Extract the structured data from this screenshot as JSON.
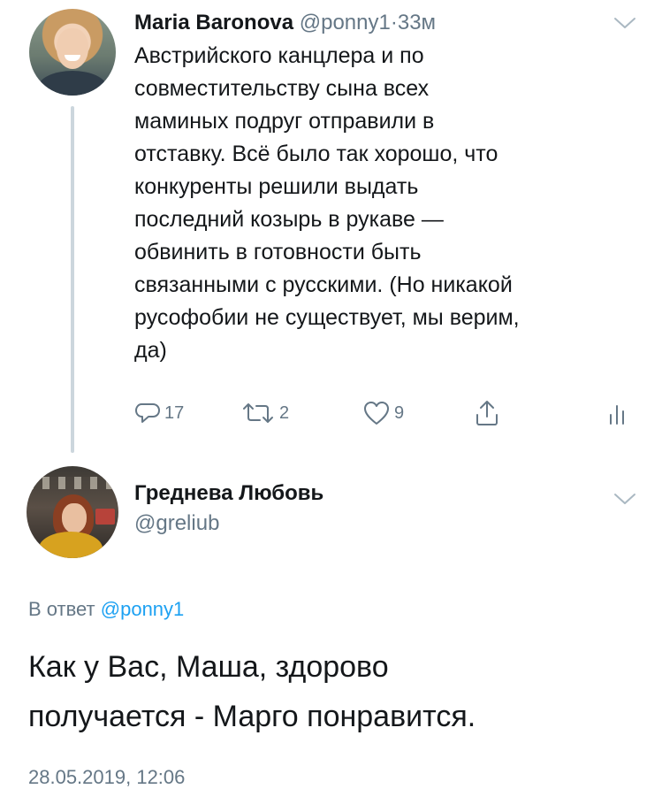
{
  "tweet1": {
    "author_name": "Maria Baronova",
    "handle": "@ponny1",
    "separator": "·",
    "time": "33м",
    "body_lines": [
      "Австрийского канцлера и по",
      "совместительству сына всех",
      "маминых подруг отправили в",
      "отставку. Всё было так хорошо, что",
      "конкуренты решили выдать",
      "последний козырь в рукаве —",
      "обвинить в готовности быть",
      "связанными с русскими. (Но никакой",
      "русофобии не существует, мы верим,",
      "да)"
    ],
    "actions": {
      "reply_count": "17",
      "retweet_count": "2",
      "like_count": "9"
    },
    "icons": [
      "avatar",
      "chevron-down-icon",
      "reply-icon",
      "retweet-icon",
      "like-icon",
      "share-icon",
      "analytics-icon"
    ]
  },
  "tweet2": {
    "author_name": "Греднева Любовь",
    "handle": "@greliub",
    "reply_prefix": "В ответ",
    "reply_handle": "@ponny1",
    "body_lines": [
      "Как у Вас, Маша, здорово",
      "получается - Марго понравится."
    ],
    "timestamp": "28.05.2019, 12:06"
  },
  "colors": {
    "text": "#14171a",
    "muted": "#657786",
    "link": "#1da1f2",
    "thread_line": "#ccd6dd"
  }
}
